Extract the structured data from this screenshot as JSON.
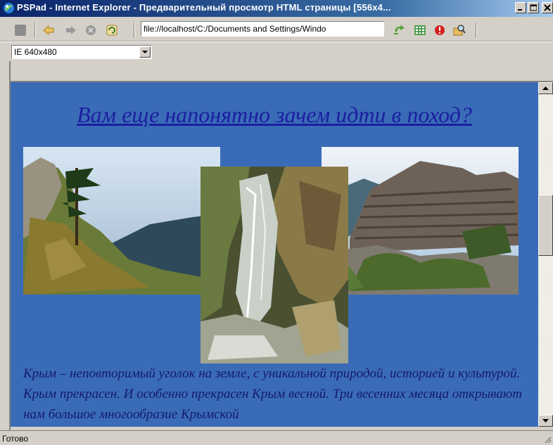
{
  "window": {
    "title": "PSPad - Internet Explorer - Предварительный просмотр HTML страницы  [556x4...",
    "buttons": [
      "minimize",
      "maximize",
      "close"
    ]
  },
  "toolbar": {
    "address": "file://localhost/C:/Documents and Settings/Windo",
    "icons": [
      "stop-square-icon",
      "back-arrow-icon",
      "forward-arrow-icon",
      "stop-icon",
      "refresh-icon",
      "go-icon",
      "table-icon",
      "error-icon",
      "search-icon"
    ]
  },
  "resolution": {
    "selected": "IE 640x480"
  },
  "page": {
    "heading": "Вам еще напонятно зачем идти в поход?",
    "paragraph": "Крым – неповторимый уголок на земле, с уникальной природой, историей и культурой. Крым прекрасен. И особенно прекрасен Крым весной. Три весенних месяца открывают нам большое многообразие Крымской",
    "photos": [
      "pine-cliff-photo",
      "waterfall-photo",
      "rock-layers-photo"
    ]
  },
  "status": {
    "text": "Готово"
  },
  "colors": {
    "page_bg": "#3a6bb7",
    "heading": "#1a1fa0",
    "text": "#141a6e"
  }
}
